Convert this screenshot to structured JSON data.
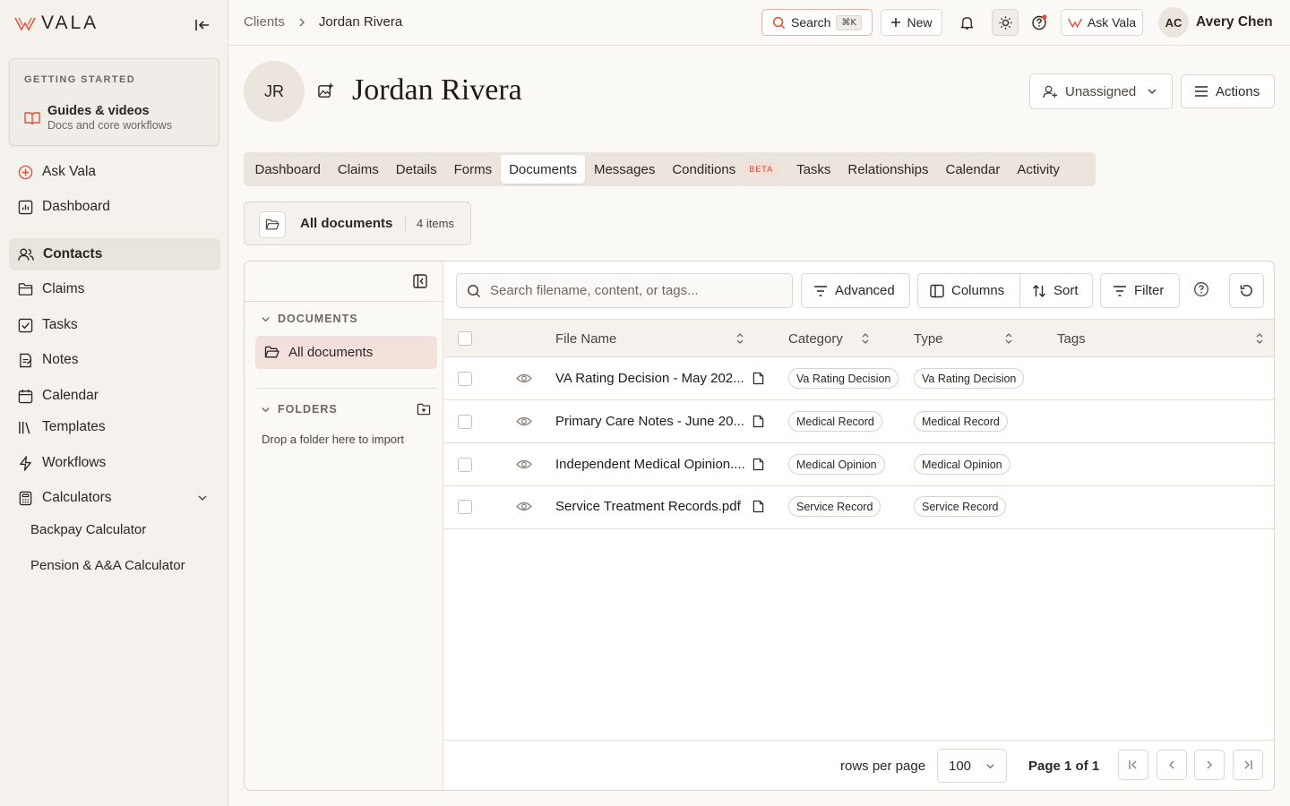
{
  "sidebar": {
    "brand": "VALA",
    "getting_started": {
      "label": "GETTING STARTED",
      "title": "Guides & videos",
      "subtitle": "Docs and core workflows"
    },
    "items": [
      {
        "label": "Ask Vala",
        "icon": "plus-circle-icon"
      },
      {
        "label": "Dashboard",
        "icon": "chart-icon"
      },
      {
        "label": "Contacts",
        "icon": "users-icon",
        "active": true
      },
      {
        "label": "Claims",
        "icon": "folder-icon"
      },
      {
        "label": "Tasks",
        "icon": "checkbox-icon"
      },
      {
        "label": "Notes",
        "icon": "note-icon"
      },
      {
        "label": "Calendar",
        "icon": "calendar-icon"
      },
      {
        "label": "Templates",
        "icon": "library-icon"
      },
      {
        "label": "Workflows",
        "icon": "bolt-icon"
      },
      {
        "label": "Calculators",
        "icon": "calculator-icon",
        "expanded": true
      }
    ],
    "sub_items": [
      "Backpay Calculator",
      "Pension & A&A Calculator"
    ]
  },
  "topbar": {
    "breadcrumb": [
      "Clients",
      "Jordan Rivera"
    ],
    "search_label": "Search",
    "search_kbd": "⌘K",
    "new_label": "New",
    "ask_label": "Ask Vala",
    "user_initials": "AC",
    "user_name": "Avery Chen"
  },
  "header": {
    "initials": "JR",
    "name": "Jordan Rivera",
    "assignee": "Unassigned",
    "actions": "Actions"
  },
  "tabs": [
    {
      "label": "Dashboard"
    },
    {
      "label": "Claims"
    },
    {
      "label": "Details"
    },
    {
      "label": "Forms"
    },
    {
      "label": "Documents",
      "active": true
    },
    {
      "label": "Messages"
    },
    {
      "label": "Conditions",
      "badge": "BETA"
    },
    {
      "label": "Tasks"
    },
    {
      "label": "Relationships"
    },
    {
      "label": "Calendar"
    },
    {
      "label": "Activity"
    }
  ],
  "doc_summary": {
    "title": "All documents",
    "count": "4 items"
  },
  "left_pane": {
    "documents_label": "DOCUMENTS",
    "all_documents": "All documents",
    "folders_label": "FOLDERS",
    "drop_hint": "Drop a folder here to import"
  },
  "toolbar": {
    "search_placeholder": "Search filename, content, or tags...",
    "advanced": "Advanced",
    "columns": "Columns",
    "sort": "Sort",
    "filter": "Filter"
  },
  "table": {
    "columns": [
      "File Name",
      "Category",
      "Type",
      "Tags"
    ],
    "rows": [
      {
        "name": "VA Rating Decision - May 202...",
        "category": "Va Rating Decision",
        "type": "Va Rating Decision"
      },
      {
        "name": "Primary Care Notes - June 20...",
        "category": "Medical Record",
        "type": "Medical Record"
      },
      {
        "name": "Independent Medical Opinion....",
        "category": "Medical Opinion",
        "type": "Medical Opinion"
      },
      {
        "name": "Service Treatment Records.pdf",
        "category": "Service Record",
        "type": "Service Record"
      }
    ]
  },
  "pagination": {
    "rows_label": "rows per page",
    "rows_value": "100",
    "page_info": "Page 1 of 1"
  },
  "colors": {
    "accent": "#e0553a",
    "active_folder": "#f3e0da",
    "sidebar_bg": "#f5f2ee"
  }
}
